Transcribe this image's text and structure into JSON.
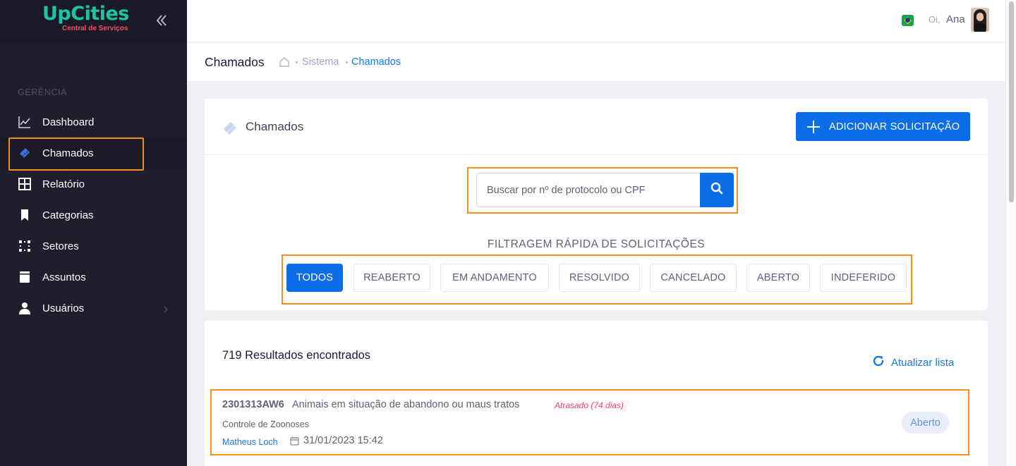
{
  "brand": {
    "name": "UpCities",
    "tagline": "Central de Serviços",
    "colors": {
      "primary": "#1bc5a3",
      "tagline": "#f64e60"
    }
  },
  "sidebar": {
    "section_label": "GERÊNCIA",
    "items": [
      {
        "label": "Dashboard",
        "icon": "chart-line-icon"
      },
      {
        "label": "Chamados",
        "icon": "ticket-icon",
        "active": true
      },
      {
        "label": "Relatório",
        "icon": "grid-icon"
      },
      {
        "label": "Categorias",
        "icon": "bookmark-icon"
      },
      {
        "label": "Setores",
        "icon": "sectors-icon"
      },
      {
        "label": "Assuntos",
        "icon": "book-icon"
      },
      {
        "label": "Usuários",
        "icon": "user-icon",
        "has_submenu": true
      }
    ]
  },
  "header": {
    "greeting": "Oi,",
    "user_name": "Ana",
    "language_flag": "brazil-flag-icon"
  },
  "subheader": {
    "title": "Chamados",
    "breadcrumb": [
      "Sistema",
      "Chamados"
    ]
  },
  "filter_card": {
    "title": "Chamados",
    "add_button": "ADICIONAR SOLICITAÇÃO",
    "search": {
      "placeholder": "Buscar por nº de protocolo ou CPF",
      "value": ""
    },
    "quick_filter_title": "FILTRAGEM RÁPIDA DE SOLICITAÇÕES",
    "filters": [
      "TODOS",
      "REABERTO",
      "EM ANDAMENTO",
      "RESOLVIDO",
      "CANCELADO",
      "ABERTO",
      "INDEFERIDO"
    ],
    "active_filter": "TODOS"
  },
  "results": {
    "count_text": "719 Resultados encontrados",
    "refresh_label": "Atualizar lista",
    "tickets": [
      {
        "protocol": "2301313AW6",
        "subject": "Animais em situação de abandono ou maus tratos",
        "delay": "Atrasado (74 dias)",
        "sector": "Controle de Zoonoses",
        "person": "Matheus Loch",
        "date": "31/01/2023 15:42",
        "status": "Aberto"
      }
    ]
  },
  "colors": {
    "accent": "#0b6ee8",
    "highlight_outline": "#f5901e",
    "late": "#f1416c",
    "sidebar_bg": "#1e1e2d"
  }
}
